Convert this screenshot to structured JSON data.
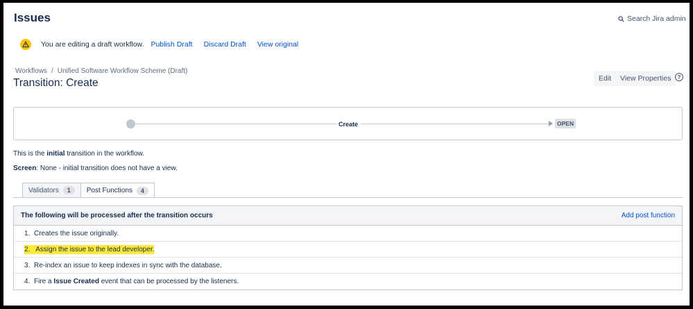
{
  "header": {
    "title": "Issues",
    "search_label": "Search Jira admin"
  },
  "banner": {
    "text": "You are editing a draft workflow.",
    "publish": "Publish Draft",
    "discard": "Discard Draft",
    "view_original": "View original"
  },
  "breadcrumb": {
    "root": "Workflows",
    "separator": "/",
    "scheme": "Unified Software Workflow Scheme (Draft)"
  },
  "transition": {
    "title": "Transition: Create"
  },
  "actions": {
    "edit": "Edit",
    "view_properties": "View Properties",
    "help": "?"
  },
  "diagram": {
    "transition_name": "Create",
    "target_status": "OPEN"
  },
  "info": {
    "prefix": "This is the ",
    "emphasis": "initial",
    "suffix": " transition in the workflow.",
    "screen_label": "Screen",
    "screen_value": ": None - initial transition does not have a view."
  },
  "tabs": [
    {
      "label": "Validators",
      "count": "1"
    },
    {
      "label": "Post Functions",
      "count": "4"
    }
  ],
  "post_functions": {
    "heading": "The following will be processed after the transition occurs",
    "add_link": "Add post function",
    "items": [
      {
        "num": "1.",
        "text": "Creates the issue originally."
      },
      {
        "num": "2.",
        "text": "Assign the issue to the lead developer."
      },
      {
        "num": "3.",
        "text": "Re-index an issue to keep indexes in sync with the database."
      },
      {
        "num": "4.",
        "pre": "Fire a ",
        "bold": "Issue Created",
        "post": " event that can be processed by the listeners."
      }
    ]
  },
  "colors": {
    "link": "#0052cc",
    "text": "#172b4d",
    "highlight": "#ffea3a",
    "warning": "#ffc400"
  }
}
